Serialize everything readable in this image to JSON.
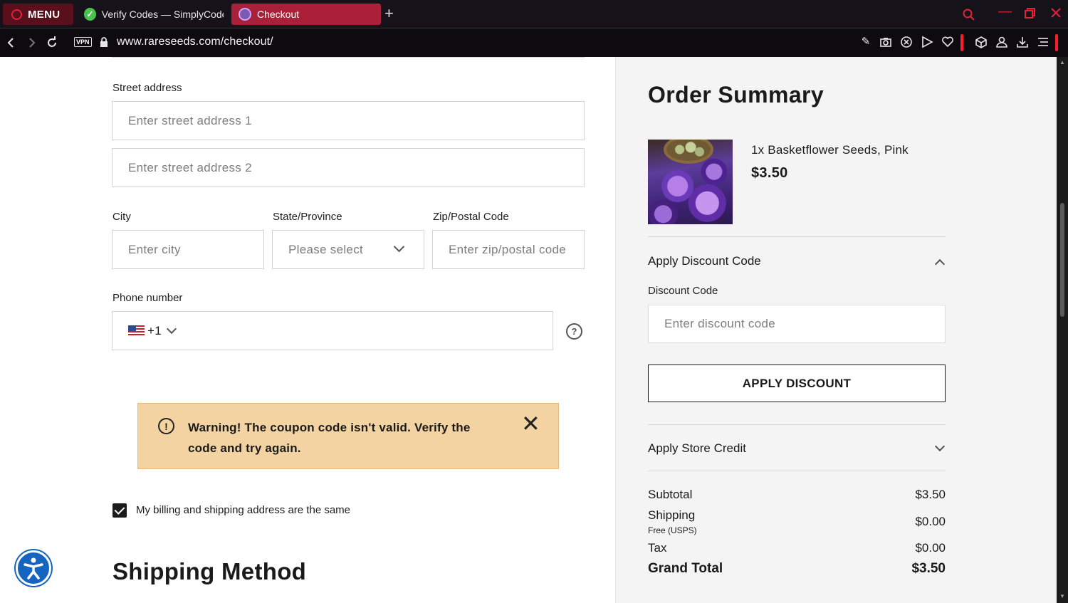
{
  "browser": {
    "menu_label": "MENU",
    "tabs": [
      {
        "label": "Verify Codes — SimplyCodes"
      },
      {
        "label": "Checkout"
      }
    ],
    "vpn_label": "VPN",
    "url": "www.rareseeds.com/checkout/"
  },
  "form": {
    "street_label": "Street address",
    "street1_placeholder": "Enter street address 1",
    "street2_placeholder": "Enter street address 2",
    "city_label": "City",
    "city_placeholder": "Enter city",
    "state_label": "State/Province",
    "state_value": "Please select",
    "zip_label": "Zip/Postal Code",
    "zip_placeholder": "Enter zip/postal code",
    "phone_label": "Phone number",
    "phone_code": "+1",
    "help_glyph": "?"
  },
  "warning": {
    "text": "Warning! The coupon code isn't valid. Verify the code and try again.",
    "icon_glyph": "!",
    "close_glyph": "✕",
    "bg_color": "#f3d3a1"
  },
  "billing_same_label": "My billing and shipping address are the same",
  "shipping_method_title": "Shipping Method",
  "summary": {
    "title": "Order Summary",
    "item": {
      "name": "1x Basketflower Seeds, Pink",
      "price": "$3.50"
    },
    "discount_title": "Apply Discount Code",
    "discount_label": "Discount Code",
    "discount_placeholder": "Enter discount code",
    "apply_button": "APPLY DISCOUNT",
    "store_credit_title": "Apply Store Credit",
    "subtotal_label": "Subtotal",
    "subtotal_value": "$3.50",
    "shipping_label": "Shipping",
    "shipping_note": "Free (USPS)",
    "shipping_value": "$0.00",
    "tax_label": "Tax",
    "tax_value": "$0.00",
    "grand_total_label": "Grand Total",
    "grand_total_value": "$3.50"
  },
  "colors": {
    "accent_red": "#e5203a",
    "active_tab": "#aa2038",
    "accessibility_blue": "#1565c0"
  }
}
